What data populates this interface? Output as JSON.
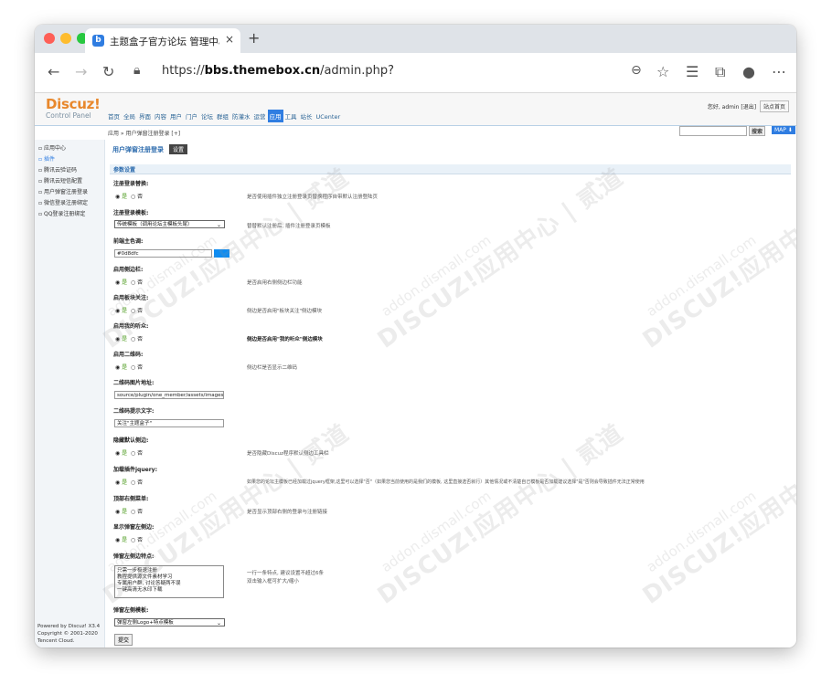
{
  "browser": {
    "tab_title": "主题盒子官方论坛 管理中心 - 应",
    "tab_close": "×",
    "new_tab": "+",
    "url_prefix": "https://",
    "url_host": "bbs.themebox.cn",
    "url_path": "/admin.php?"
  },
  "header": {
    "logo": "Discuz!",
    "subtitle": "Control Panel",
    "nav": [
      "首页",
      "全局",
      "界面",
      "内容",
      "用户",
      "门户",
      "论坛",
      "群组",
      "防灌水",
      "运营",
      "应用",
      "工具",
      "站长",
      "UCenter"
    ],
    "active_nav": "应用",
    "greeting": "您好, admin",
    "logout": "[退出]",
    "site_home": "站点首页"
  },
  "crumb": {
    "text": "应用 » 用户弹窗注册登录  [+]",
    "search_button": "搜索",
    "map_button": "MAP ⬇"
  },
  "sidebar": {
    "items": [
      "应用中心",
      "插件",
      "腾讯云验证码",
      "腾讯云短信配置",
      "用户弹窗注册登录",
      "微信登录注册绑定",
      "QQ登录注册绑定"
    ],
    "active_index": 1,
    "footer": [
      "Powered by Discuz! X3.4",
      "Copyright © 2001-2020",
      "Tencent Cloud."
    ]
  },
  "page": {
    "title": "用户弹窗注册登录",
    "settings_button": "设置",
    "section": "参数设置",
    "fields": [
      {
        "label": "注册登录替换:",
        "type": "radio",
        "yes": "是",
        "no": "否",
        "hint": "是否使用插件独立注册登录页替换程序自带默认注册登陆页"
      },
      {
        "label": "注册登录模板:",
        "type": "select",
        "value": "传统模板（调用论坛主模板头尾）",
        "hint": "替替默认注册后, 插件注册登录页模板"
      },
      {
        "label": "前端主色调:",
        "type": "color",
        "value": "#0d8dfc",
        "hint": ""
      },
      {
        "label": "启用侧边栏:",
        "type": "radio",
        "yes": "是",
        "no": "否",
        "hint": "是否启用右侧侧边栏功能"
      },
      {
        "label": "启用板块关注:",
        "type": "radio",
        "yes": "是",
        "no": "否",
        "hint": "侧边是否启用\"板块关注\"侧边模块"
      },
      {
        "label": "启用我的听众:",
        "type": "radio",
        "yes": "是",
        "no": "否",
        "hint": "侧边是否启用\"我的听众\"侧边模块"
      },
      {
        "label": "启用二维码:",
        "type": "radio",
        "yes": "是",
        "no": "否",
        "hint": "侧边栏是否显示二维码"
      },
      {
        "label": "二维码图片地址:",
        "type": "text",
        "value": "source/plugin/one_member/assets/images",
        "hint": ""
      },
      {
        "label": "二维码提示文字:",
        "type": "text",
        "value": "关注\"主题盒子\"",
        "hint": ""
      },
      {
        "label": "隐藏默认侧边:",
        "type": "radio",
        "yes": "是",
        "no": "否",
        "hint": "是否隐藏Discuz程序默认侧边工具栏"
      },
      {
        "label": "加载插件jquery:",
        "type": "radio",
        "yes": "是",
        "no": "否",
        "hint": "如果您的论坛主模板已经加载过jquery框架,这里可以选择\"否\"（如果您当前使用的是我们的模板, 这里直接选否就行）其他情况或不清楚自己模板是否加载建议选择\"是\"否则会导致插件无法正常使用"
      },
      {
        "label": "顶部右侧菜单:",
        "type": "radio",
        "yes": "是",
        "no": "否",
        "hint": "是否显示顶部右侧的登录与注册链接"
      },
      {
        "label": "显示弹窗左侧边:",
        "type": "radio",
        "yes": "是",
        "no": "否",
        "hint": ""
      },
      {
        "label": "弹窗左侧边特点:",
        "type": "textarea",
        "lines": [
          "只需一步极速注册",
          "教程提供源文件素材学习",
          "专属用户群, 讨论答疑两不误",
          "一键高清无水印下载"
        ],
        "hint_lines": [
          "一行一条特点, 建议设置不超过6条",
          "双击输入框可扩大/缩小"
        ]
      },
      {
        "label": "弹窗左侧模板:",
        "type": "select",
        "value": "弹窗左侧Logo+特点模板",
        "hint": ""
      }
    ],
    "submit": "提交"
  },
  "watermark": {
    "text1": "DISCUZ!应用中心 | 贰道",
    "text2": "addon.dismall.com"
  }
}
